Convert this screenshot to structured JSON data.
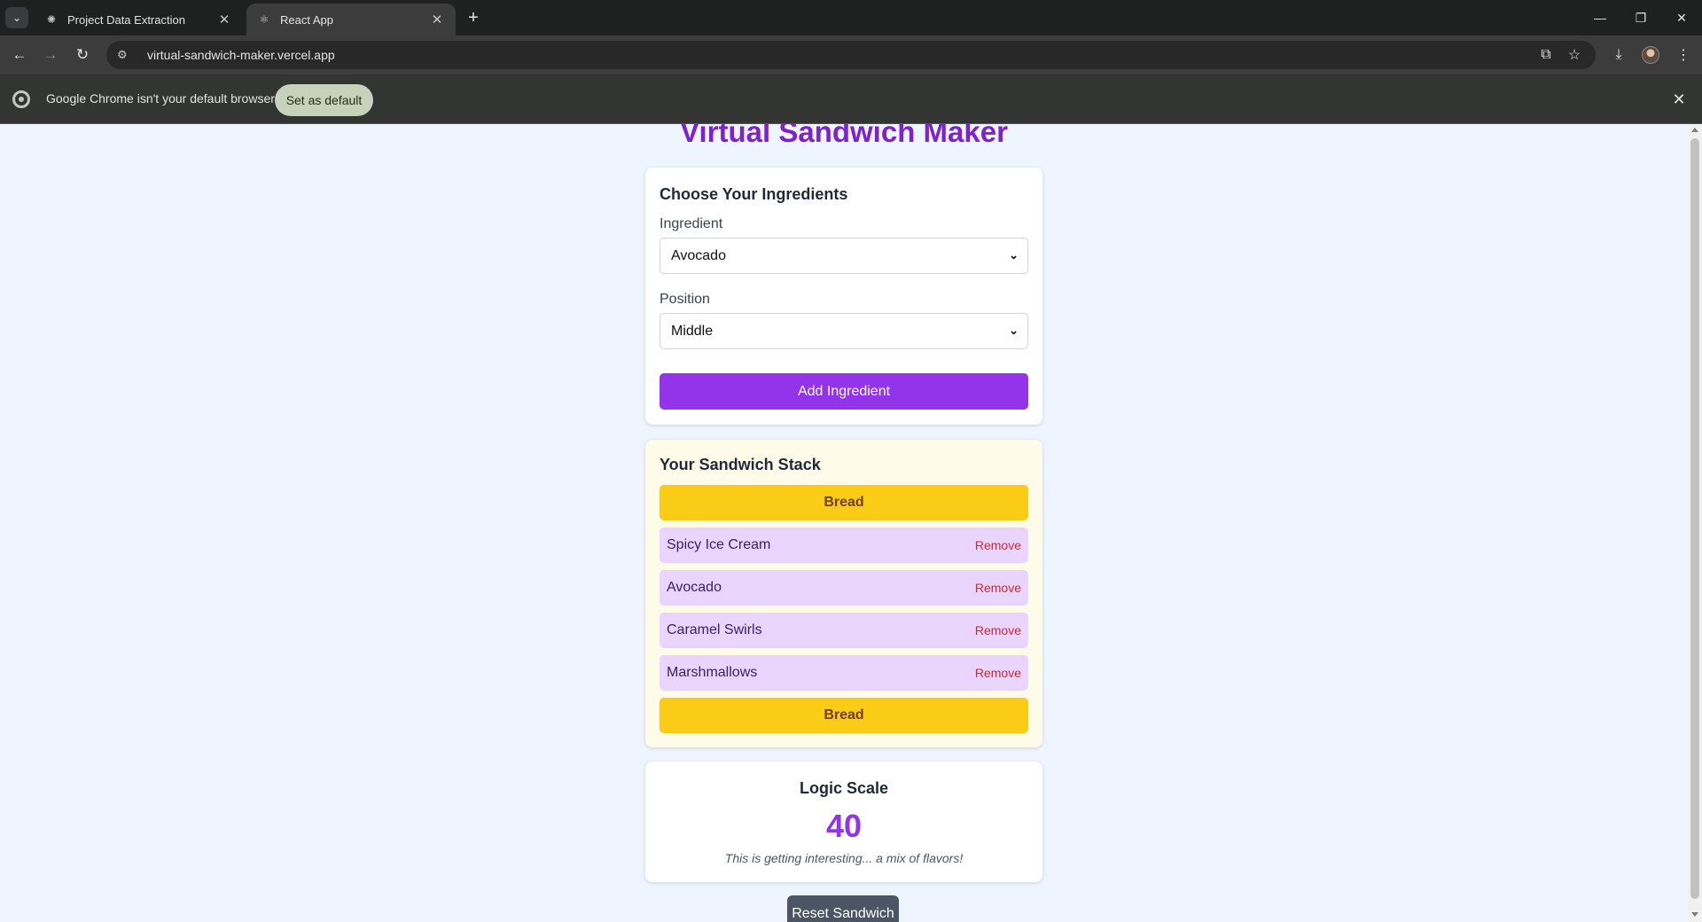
{
  "browser": {
    "tabs": [
      {
        "title": "Project Data Extraction",
        "active": false
      },
      {
        "title": "React App",
        "active": true
      }
    ],
    "url": "virtual-sandwich-maker.vercel.app",
    "infobar": {
      "message": "Google Chrome isn't your default browser",
      "button": "Set as default"
    }
  },
  "page": {
    "title": "Virtual Sandwich Maker",
    "controls": {
      "heading": "Choose Your Ingredients",
      "ingredient_label": "Ingredient",
      "ingredient_value": "Avocado",
      "position_label": "Position",
      "position_value": "Middle",
      "add_button": "Add Ingredient"
    },
    "stack": {
      "heading": "Your Sandwich Stack",
      "top_bread": "Bread",
      "items": [
        {
          "name": "Spicy Ice Cream",
          "action": "Remove"
        },
        {
          "name": "Avocado",
          "action": "Remove"
        },
        {
          "name": "Caramel Swirls",
          "action": "Remove"
        },
        {
          "name": "Marshmallows",
          "action": "Remove"
        }
      ],
      "bottom_bread": "Bread"
    },
    "logic": {
      "title": "Logic Scale",
      "score": "40",
      "comment": "This is getting interesting... a mix of flavors!"
    },
    "reset_button": "Reset Sandwich"
  },
  "colors": {
    "accent": "#9333ea",
    "title": "#7e22ce",
    "bread": "#facc15",
    "ingredient": "#e9d5ff",
    "remove": "#dc2626",
    "background": "#eff5ff"
  }
}
